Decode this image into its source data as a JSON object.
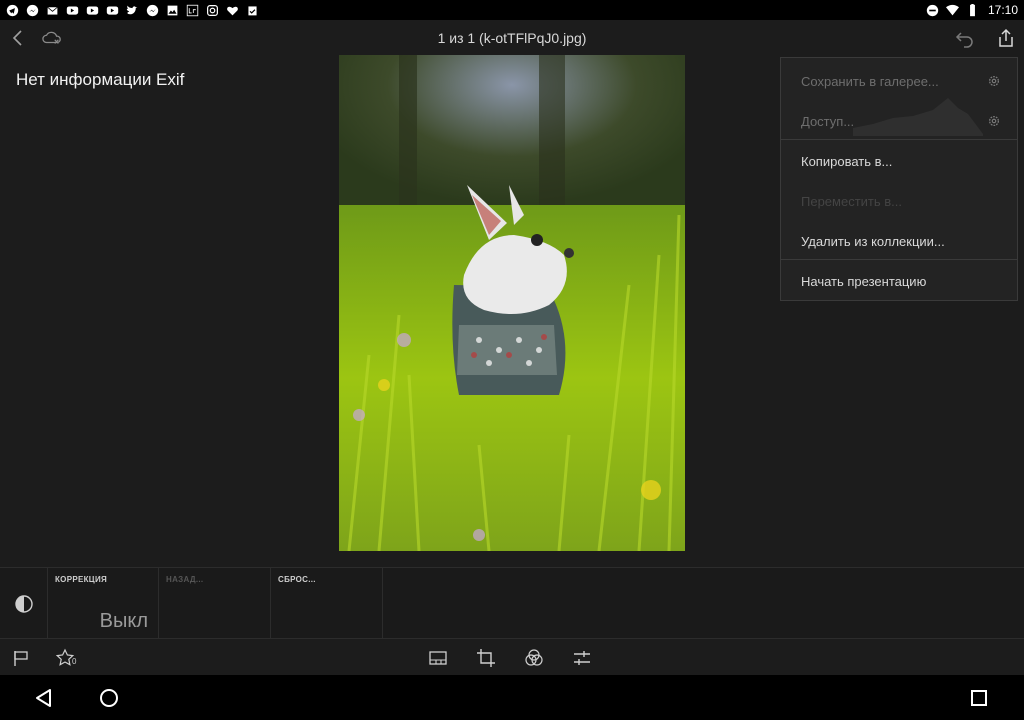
{
  "status_bar": {
    "time": "17:10",
    "left_icons": [
      "telegram-icon",
      "messenger-icon",
      "mail-icon",
      "youtube-icon",
      "youtube-icon",
      "youtube-icon",
      "twitter-icon",
      "messenger-icon",
      "image-icon",
      "lightroom-icon",
      "instagram-icon",
      "heart-icon",
      "clipboard-check-icon"
    ],
    "right_icons": [
      "do-not-disturb-icon",
      "wifi-icon",
      "battery-icon"
    ]
  },
  "topbar": {
    "title": "1 из 1 (k-otTFlPqJ0.jpg)",
    "icons": [
      "back-icon",
      "cloud-off-icon",
      "undo-icon",
      "share-icon"
    ]
  },
  "exif_text": "Нет информации Exif",
  "menu": {
    "items": [
      {
        "label": "Сохранить в галерее...",
        "enabled": false,
        "has_gear": true
      },
      {
        "label": "Доступ...",
        "enabled": false,
        "has_gear": true
      },
      {
        "label": "Копировать в...",
        "enabled": true,
        "has_gear": false
      },
      {
        "label": "Переместить в...",
        "enabled": false,
        "has_gear": false
      },
      {
        "label": "Удалить из коллекции...",
        "enabled": true,
        "has_gear": false
      },
      {
        "label": "Начать презентацию",
        "enabled": true,
        "has_gear": false
      }
    ]
  },
  "panel": {
    "correction_label": "КОРРЕКЦИЯ",
    "correction_value": "Выкл",
    "back_label": "НАЗАД...",
    "reset_label": "СБРОС..."
  },
  "toolbar": {
    "star_count": "0",
    "tools": [
      "flag-icon",
      "star-icon",
      "presets-icon",
      "crop-icon",
      "color-icon",
      "adjust-icon"
    ]
  },
  "navbar": {
    "buttons": [
      "nav-back-icon",
      "nav-home-icon",
      "nav-recents-icon"
    ]
  },
  "colors": {
    "background": "#1c1c1c",
    "text_enabled": "#d9d9d9",
    "text_disabled": "#6e6e6e",
    "text_disabled_faint": "#444444"
  }
}
